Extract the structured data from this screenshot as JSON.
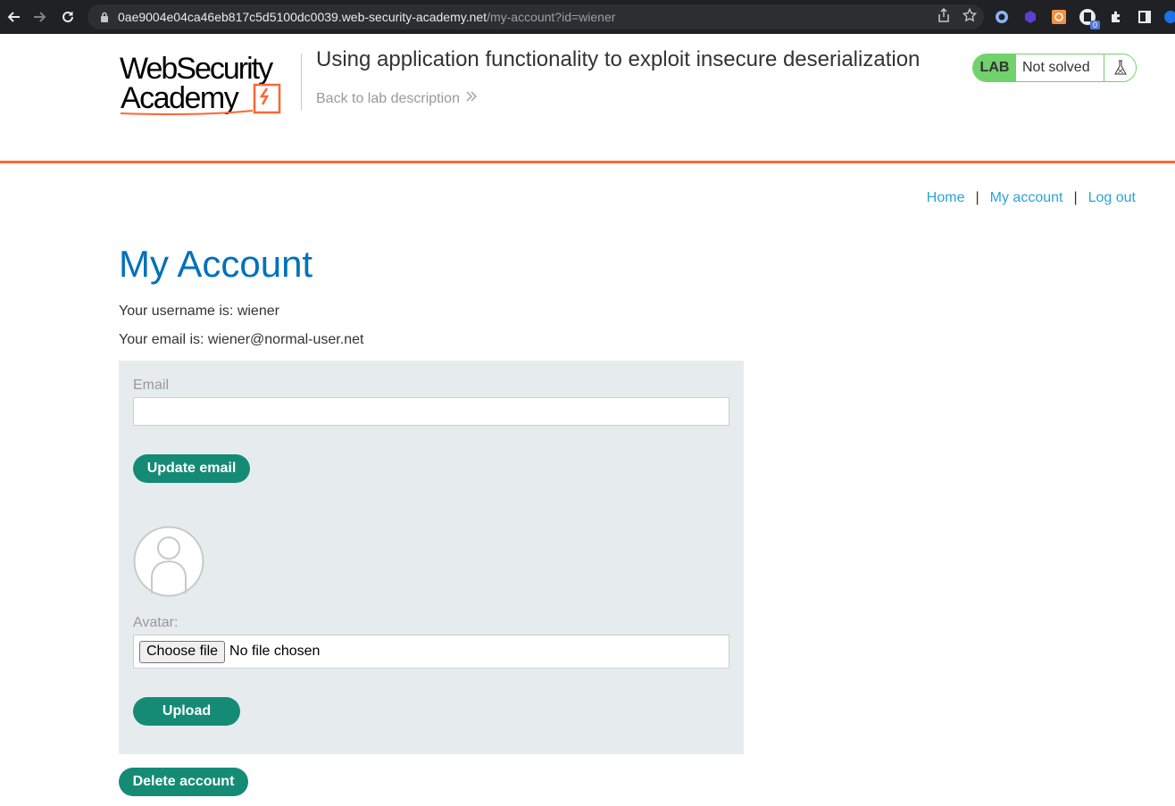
{
  "browser": {
    "url_host": "0ae9004e04ca46eb817c5d5100dc0039.web-security-academy.net",
    "url_path": "/my-account?id=wiener",
    "extension_badge": "0"
  },
  "header": {
    "logo_line1": "WebSecurity",
    "logo_line2": "Academy",
    "lab_title": "Using application functionality to exploit insecure deserialization",
    "back_link": "Back to lab description",
    "lab_badge": "LAB",
    "lab_status": "Not solved"
  },
  "nav": {
    "home": "Home",
    "separator": "|",
    "my_account": "My account",
    "log_out": "Log out"
  },
  "account": {
    "title": "My Account",
    "username_line": "Your username is: wiener",
    "email_line": "Your email is: wiener@normal-user.net"
  },
  "form": {
    "email_label": "Email",
    "email_value": "",
    "update_email_button": "Update email",
    "avatar_label": "Avatar:",
    "choose_file_button": "Choose file",
    "file_status": "No file chosen",
    "upload_button": "Upload"
  },
  "delete_button": "Delete account",
  "colors": {
    "brand_orange": "#ff6633",
    "title_blue": "#0071bc",
    "link_blue": "#29a3d9",
    "button_green": "#158b76",
    "lab_green": "#70d16d",
    "panel_gray": "#e6ecee"
  },
  "icons": [
    "back-arrow-icon",
    "forward-arrow-icon",
    "reload-icon",
    "lock-icon",
    "share-icon",
    "star-icon",
    "extension-icon",
    "sidebar-icon",
    "chevrons-right-icon",
    "flask-icon",
    "avatar-placeholder-icon"
  ]
}
